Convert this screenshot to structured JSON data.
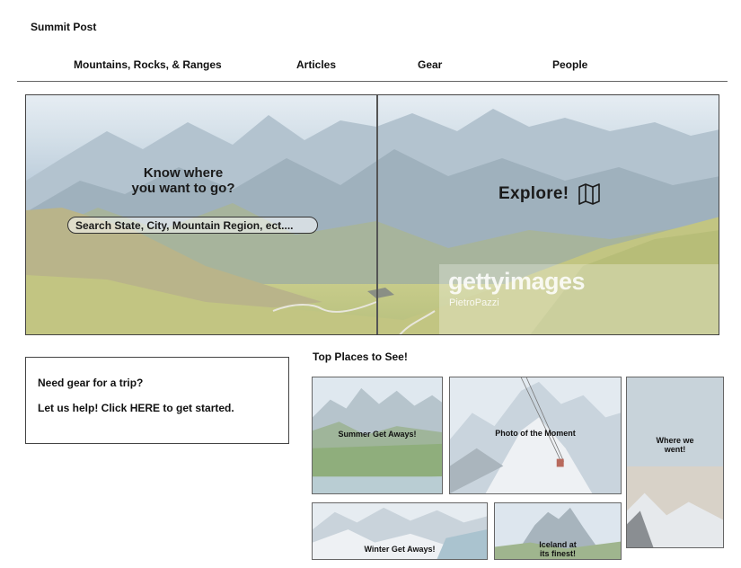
{
  "site": {
    "title": "Summit Post"
  },
  "nav": {
    "items": [
      {
        "label": "Mountains, Rocks, & Ranges"
      },
      {
        "label": "Articles"
      },
      {
        "label": "Gear"
      },
      {
        "label": "People"
      }
    ]
  },
  "hero": {
    "question_line1": "Know where",
    "question_line2": "you want to go?",
    "search_placeholder": "Search State, City, Mountain Region, ect....",
    "explore_label": "Explore!",
    "explore_icon": "map-icon",
    "watermark_brand": "gettyimages",
    "watermark_credit": "PietroPazzi"
  },
  "gear_promo": {
    "line1": "Need gear for a trip?",
    "line2_prefix": "Let us help! Click ",
    "line2_link": "HERE",
    "line2_suffix": " to get started."
  },
  "places": {
    "heading": "Top Places to See!",
    "tiles": [
      {
        "label": "Summer Get Aways!"
      },
      {
        "label": "Photo of the Moment"
      },
      {
        "label_line1": "Where we",
        "label_line2": "went!"
      },
      {
        "label": "Winter Get Aways!"
      },
      {
        "label_line1": "Iceland at",
        "label_line2": "its finest!"
      }
    ]
  },
  "colors": {
    "sky": "#d3dfe8",
    "mountain": "#9fb2c0",
    "meadow": "#c8cc8a",
    "border": "#444444"
  }
}
